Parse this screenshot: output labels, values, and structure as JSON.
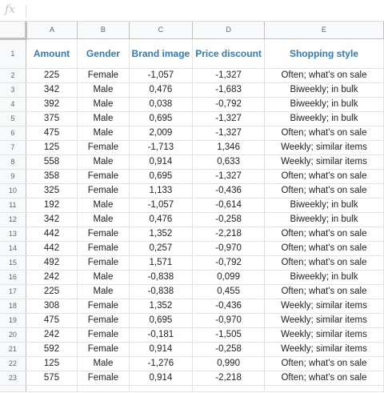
{
  "formula_bar": {
    "fx_label": "fx",
    "value": ""
  },
  "columns": [
    "A",
    "B",
    "C",
    "D",
    "E"
  ],
  "header_row_number": "1",
  "headers": [
    "Amount",
    "Gender",
    "Brand image",
    "Price discount",
    "Shopping style"
  ],
  "rows": [
    {
      "n": "2",
      "cells": [
        "225",
        "Female",
        "-1,057",
        "-1,327",
        "Often; what's on sale"
      ]
    },
    {
      "n": "3",
      "cells": [
        "342",
        "Male",
        "0,476",
        "-1,683",
        "Biweekly; in bulk"
      ]
    },
    {
      "n": "4",
      "cells": [
        "392",
        "Male",
        "0,038",
        "-0,792",
        "Biweekly; in bulk"
      ]
    },
    {
      "n": "5",
      "cells": [
        "375",
        "Male",
        "0,695",
        "-1,327",
        "Biweekly; in bulk"
      ]
    },
    {
      "n": "6",
      "cells": [
        "475",
        "Male",
        "2,009",
        "-1,327",
        "Often; what's on sale"
      ]
    },
    {
      "n": "7",
      "cells": [
        "125",
        "Female",
        "-1,713",
        "1,346",
        "Weekly; similar items"
      ]
    },
    {
      "n": "8",
      "cells": [
        "558",
        "Male",
        "0,914",
        "0,633",
        "Weekly; similar items"
      ]
    },
    {
      "n": "9",
      "cells": [
        "358",
        "Female",
        "0,695",
        "-1,327",
        "Often; what's on sale"
      ]
    },
    {
      "n": "10",
      "cells": [
        "325",
        "Female",
        "1,133",
        "-0,436",
        "Often; what's on sale"
      ]
    },
    {
      "n": "11",
      "cells": [
        "192",
        "Male",
        "-1,057",
        "-0,614",
        "Biweekly; in bulk"
      ]
    },
    {
      "n": "12",
      "cells": [
        "342",
        "Male",
        "0,476",
        "-0,258",
        "Biweekly; in bulk"
      ]
    },
    {
      "n": "13",
      "cells": [
        "442",
        "Female",
        "1,352",
        "-2,218",
        "Often; what's on sale"
      ]
    },
    {
      "n": "14",
      "cells": [
        "442",
        "Female",
        "0,257",
        "-0,970",
        "Often; what's on sale"
      ]
    },
    {
      "n": "15",
      "cells": [
        "492",
        "Female",
        "1,571",
        "-0,792",
        "Often; what's on sale"
      ]
    },
    {
      "n": "16",
      "cells": [
        "242",
        "Male",
        "-0,838",
        "0,099",
        "Biweekly; in bulk"
      ]
    },
    {
      "n": "17",
      "cells": [
        "225",
        "Male",
        "-0,838",
        "0,455",
        "Often; what's on sale"
      ]
    },
    {
      "n": "18",
      "cells": [
        "308",
        "Female",
        "1,352",
        "-0,436",
        "Weekly; similar items"
      ]
    },
    {
      "n": "19",
      "cells": [
        "475",
        "Female",
        "0,695",
        "-0,970",
        "Weekly; similar items"
      ]
    },
    {
      "n": "20",
      "cells": [
        "242",
        "Female",
        "-0,181",
        "-1,505",
        "Weekly; similar items"
      ]
    },
    {
      "n": "21",
      "cells": [
        "592",
        "Female",
        "0,914",
        "-0,258",
        "Weekly; similar items"
      ]
    },
    {
      "n": "22",
      "cells": [
        "125",
        "Male",
        "-1,276",
        "0,990",
        "Often; what's on sale"
      ]
    },
    {
      "n": "23",
      "cells": [
        "575",
        "Female",
        "0,914",
        "-2,218",
        "Often; what's on sale"
      ]
    }
  ],
  "colors": {
    "header_text": "#2f7bbf",
    "grid_header_bg": "#f8f9fa",
    "gridline": "#e2e3e3"
  }
}
